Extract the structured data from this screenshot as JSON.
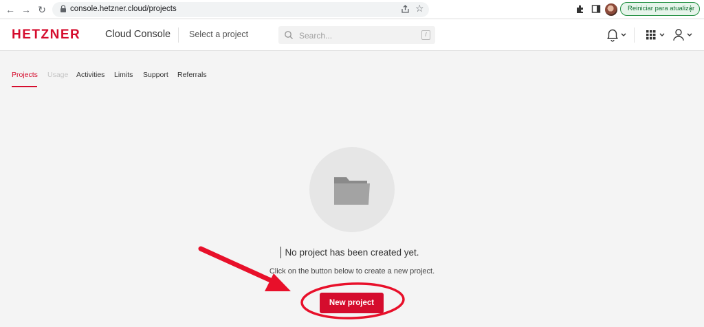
{
  "browser": {
    "url": "console.hetzner.cloud/projects",
    "update_label": "Reiniciar para atualizar"
  },
  "header": {
    "logo": "HETZNER",
    "title": "Cloud Console",
    "project_select": "Select a project",
    "search_placeholder": "Search...",
    "search_shortcut": "/"
  },
  "tabs": [
    {
      "label": "Projects",
      "state": "active"
    },
    {
      "label": "Usage",
      "state": "disabled"
    },
    {
      "label": "Activities",
      "state": "normal"
    },
    {
      "label": "Limits",
      "state": "normal"
    },
    {
      "label": "Support",
      "state": "normal"
    },
    {
      "label": "Referrals",
      "state": "normal"
    }
  ],
  "empty_state": {
    "title": "No project has been created yet.",
    "subtitle": "Click on the button below to create a new project.",
    "button": "New project",
    "icon": "folder-icon"
  },
  "colors": {
    "brand_red": "#d50c2d",
    "annotation_red": "#e8102a",
    "background": "#f4f4f4"
  }
}
